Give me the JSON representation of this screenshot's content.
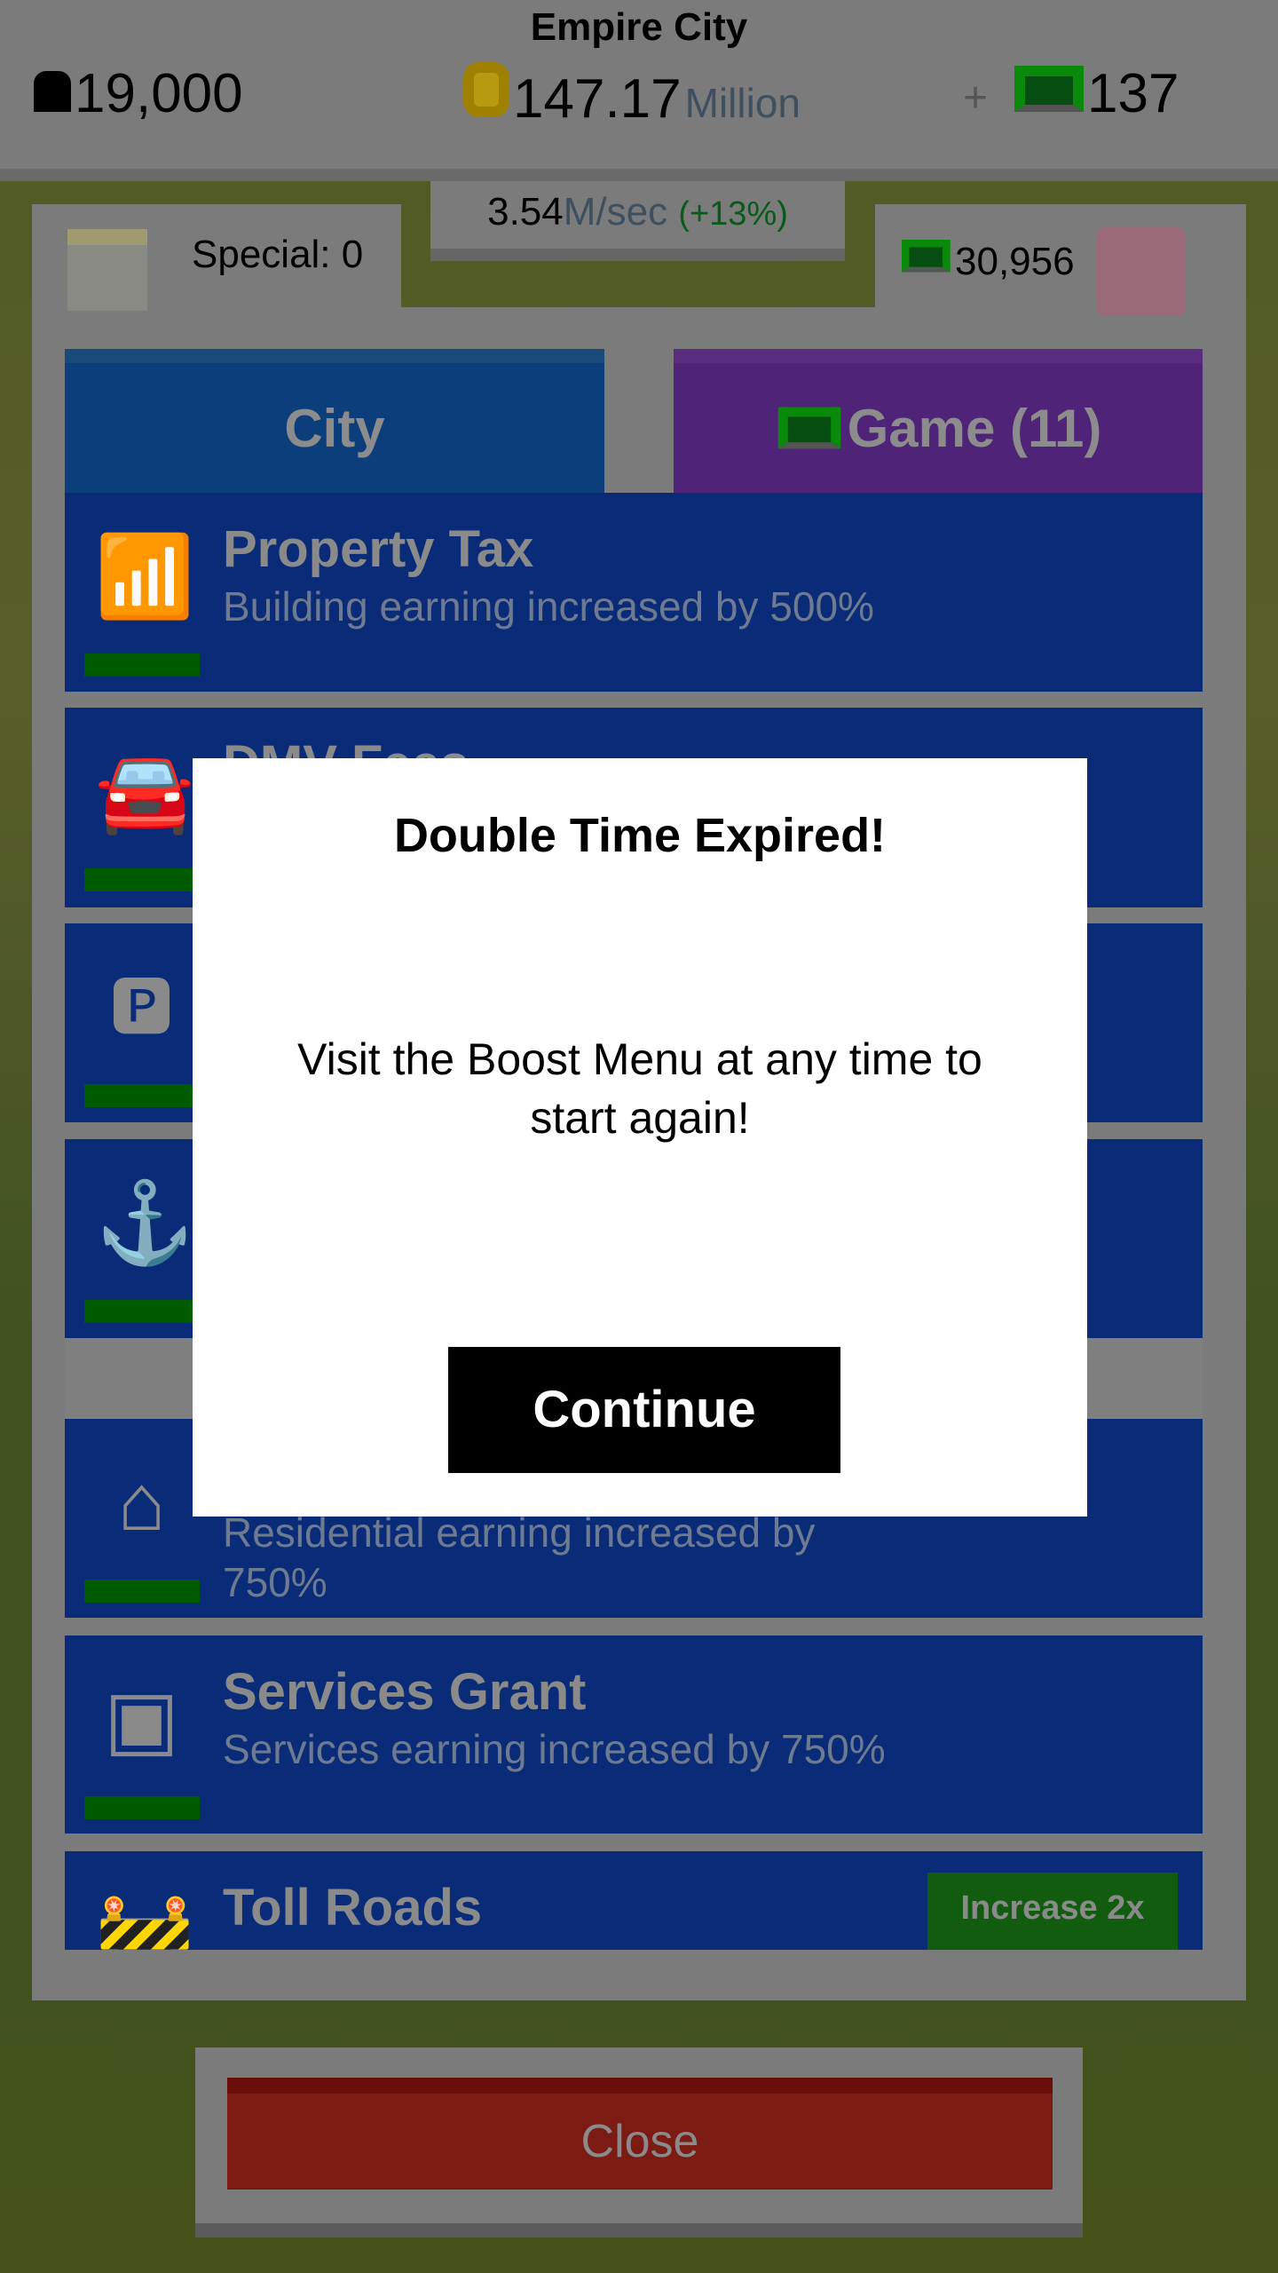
{
  "header": {
    "city_name": "Empire City",
    "population": "19,000",
    "money": "147.17",
    "money_unit": "Million",
    "plus": "+",
    "gems": "137"
  },
  "rate": {
    "value": "3.54",
    "unit": "M/sec",
    "bonus": "(+13%)"
  },
  "special": {
    "label": "Special: 0"
  },
  "bank": {
    "gems": "30,956"
  },
  "tabs": [
    {
      "label": "City"
    },
    {
      "label": "Game (11)"
    }
  ],
  "items": [
    {
      "title": "Property Tax",
      "desc": "Building earning increased by 500%",
      "icon": "chart-growth-icon"
    },
    {
      "title": "DMV Fees",
      "desc": "",
      "icon": "car-icon"
    },
    {
      "title": "",
      "desc": "",
      "icon": "parking-icon"
    },
    {
      "title": "",
      "desc": "",
      "icon": "crane-hook-icon"
    },
    {
      "title": "",
      "desc": "Residential earning increased by 750%",
      "icon": "house-icon"
    },
    {
      "title": "Services Grant",
      "desc": "Services earning increased by 750%",
      "icon": "hand-box-icon"
    },
    {
      "title": "Toll Roads",
      "desc": "",
      "icon": "toll-gate-icon",
      "button": "Increase 2x"
    }
  ],
  "modal": {
    "title": "Double Time Expired!",
    "body": "Visit the Boost Menu at any time to start again!",
    "button": "Continue"
  },
  "close": {
    "label": "Close"
  },
  "colors": {
    "item_blue": "#0a2c78",
    "city_tab": "#0d3e7c",
    "game_tab": "#4e2378",
    "progress": "#005a00",
    "close": "#7c1a14"
  }
}
